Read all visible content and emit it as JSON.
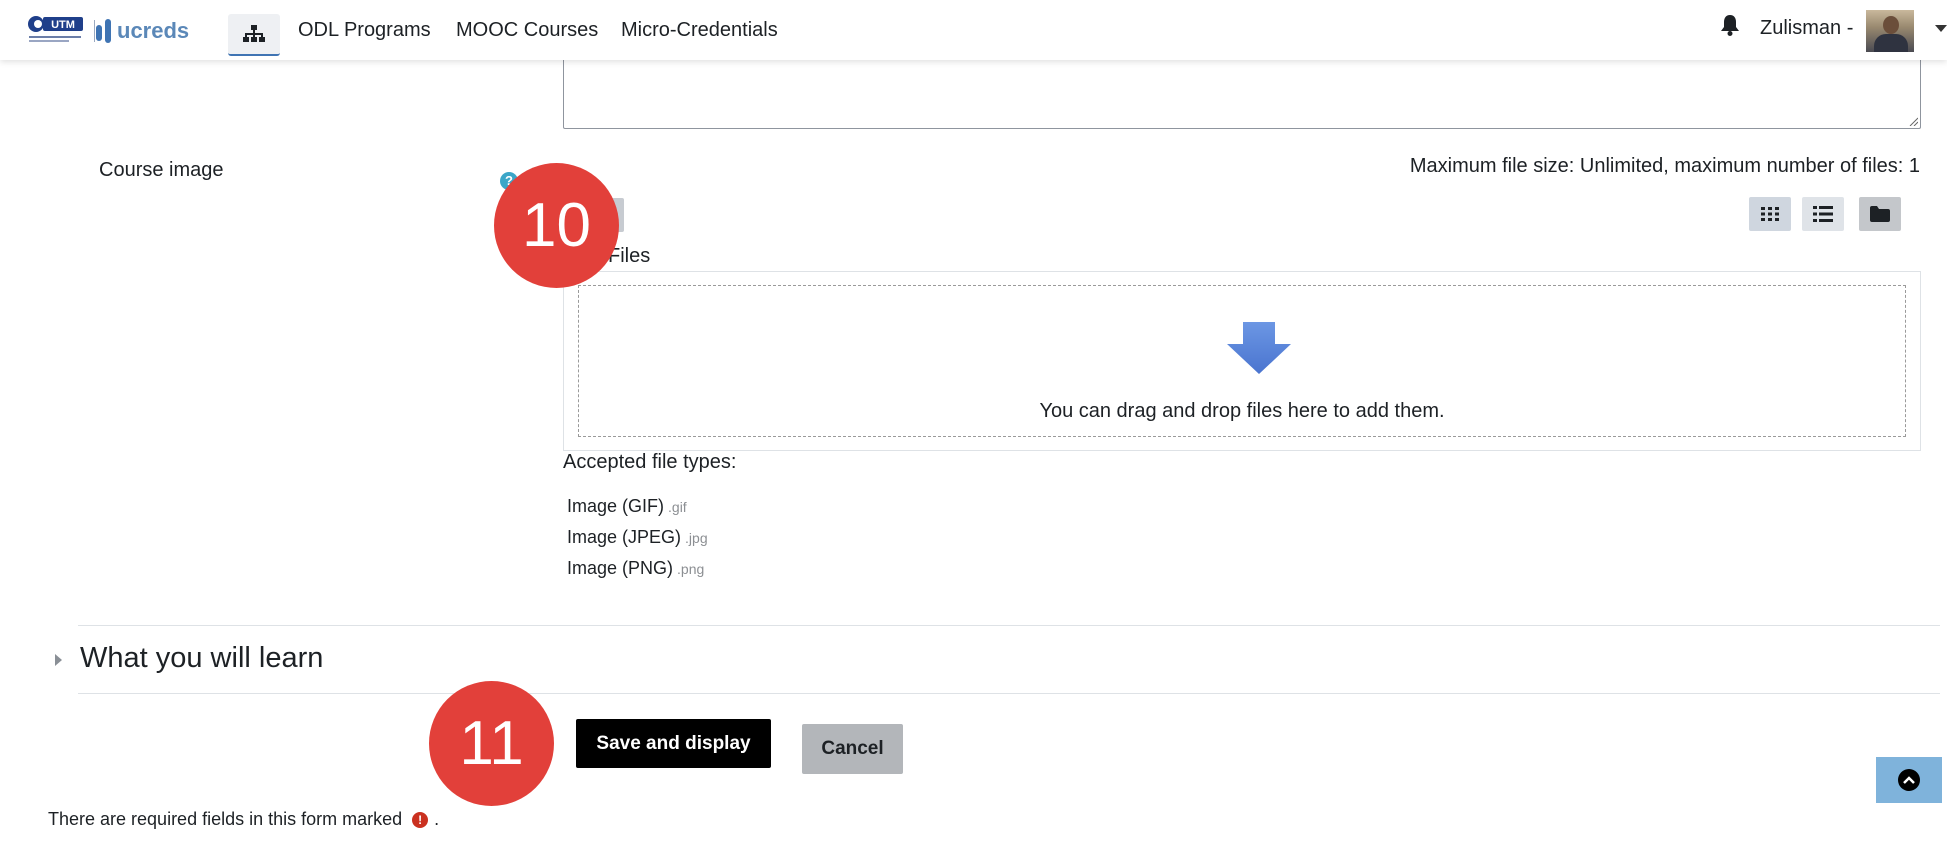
{
  "navbar": {
    "brand_name": "ucreds",
    "utm_logo_text": "UTM",
    "links": [
      "ODL Programs",
      "MOOC Courses",
      "Micro-Credentials"
    ],
    "user_name": "Zulisman -"
  },
  "form": {
    "course_image_label": "Course image",
    "help_icon_glyph": "?",
    "max_file_info": "Maximum file size: Unlimited, maximum number of files: 1",
    "files_label": "Files",
    "dropzone_text": "You can drag and drop files here to add them.",
    "accepted_title": "Accepted file types:",
    "accepted_types": [
      {
        "name": "Image (GIF)",
        "ext": ".gif"
      },
      {
        "name": "Image (JPEG)",
        "ext": ".jpg"
      },
      {
        "name": "Image (PNG)",
        "ext": ".png"
      }
    ],
    "view_icons": [
      "grid-view-icon",
      "list-view-icon",
      "folder-view-icon"
    ]
  },
  "section": {
    "title": "What you will learn"
  },
  "actions": {
    "save_label": "Save and display",
    "cancel_label": "Cancel"
  },
  "footer": {
    "required_note": "There are required fields in this form marked",
    "required_icon_glyph": "!",
    "required_suffix": "."
  },
  "annotations": {
    "step_10": "10",
    "step_11": "11"
  },
  "colors": {
    "step_badge": "#e2403a",
    "save_button": "#000000",
    "cancel_button": "#b3b6ba",
    "drop_arrow": "#5b86d8",
    "back_to_top": "#7fb3db"
  }
}
